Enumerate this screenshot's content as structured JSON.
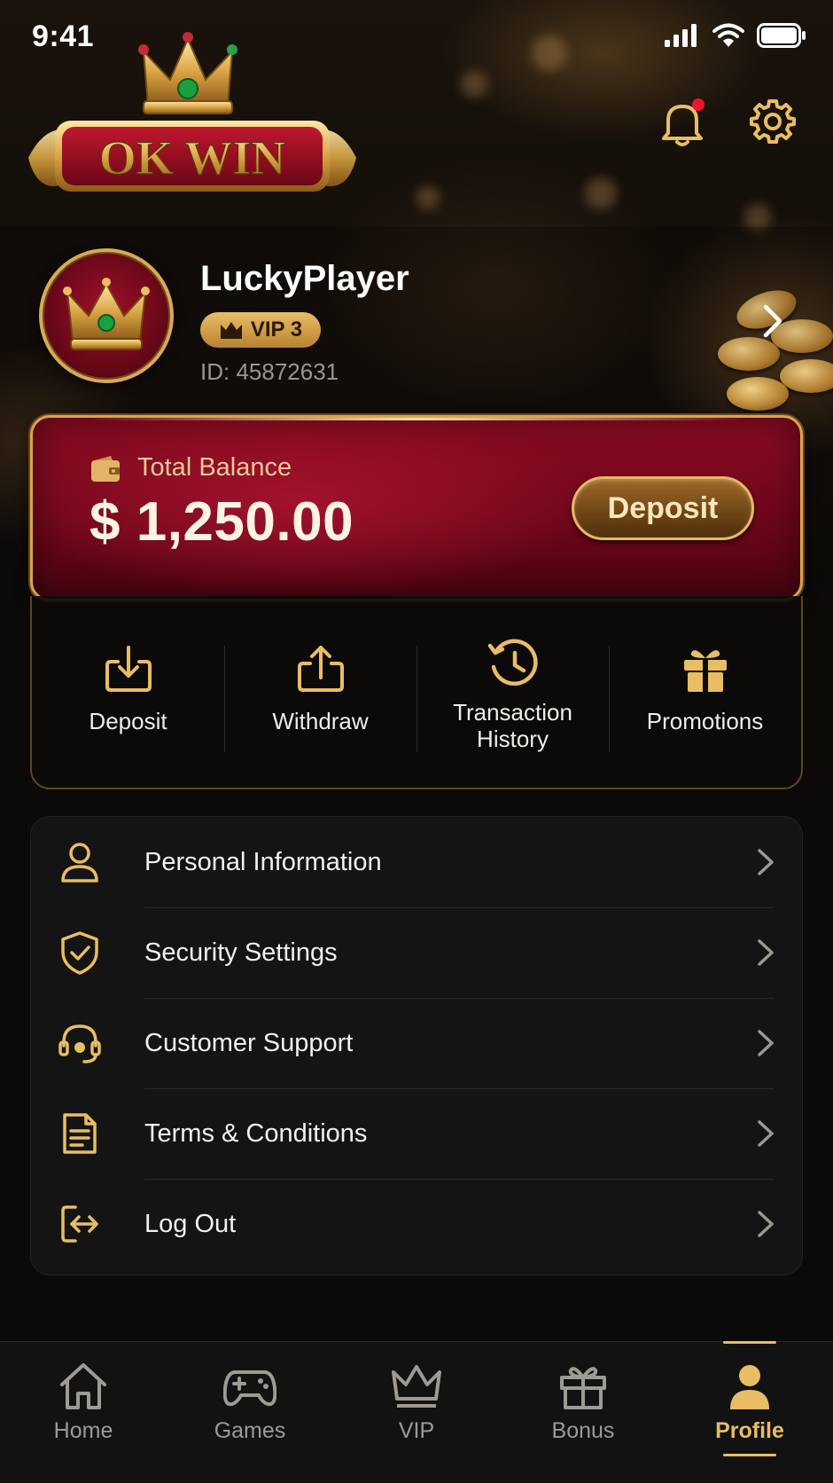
{
  "status_bar": {
    "time": "9:41",
    "icons": [
      "cellular-signal-icon",
      "wifi-icon",
      "battery-icon"
    ]
  },
  "header": {
    "logo_text": "OK WIN",
    "icons": [
      "bell-icon",
      "gear-icon"
    ],
    "notification_dot_color": "#e8182c"
  },
  "profile": {
    "username": "LuckyPlayer",
    "vip_label": "VIP 3",
    "player_id": "ID: 45872631"
  },
  "balance": {
    "label": "Total Balance",
    "amount": "$ 1,250.00",
    "deposit_button": "Deposit"
  },
  "quick_actions": [
    {
      "label": "Deposit",
      "icon": "deposit-icon"
    },
    {
      "label": "Withdraw",
      "icon": "withdraw-icon"
    },
    {
      "label": "Transaction History",
      "icon": "history-icon"
    },
    {
      "label": "Promotions",
      "icon": "gift-icon"
    }
  ],
  "menu": [
    {
      "label": "Personal Information",
      "icon": "user-icon"
    },
    {
      "label": "Security Settings",
      "icon": "shield-check-icon"
    },
    {
      "label": "Customer Support",
      "icon": "headset-icon"
    },
    {
      "label": "Terms & Conditions",
      "icon": "document-icon"
    },
    {
      "label": "Log Out",
      "icon": "logout-icon"
    }
  ],
  "bottom_nav": [
    {
      "label": "Home",
      "icon": "home-icon",
      "active": false
    },
    {
      "label": "Games",
      "icon": "gamepad-icon",
      "active": false
    },
    {
      "label": "VIP",
      "icon": "crown-icon",
      "active": false
    },
    {
      "label": "Bonus",
      "icon": "gift-icon",
      "active": false
    },
    {
      "label": "Profile",
      "icon": "user-icon",
      "active": true
    }
  ],
  "colors": {
    "gold": "#e9bd63",
    "crimson": "#8a0b22",
    "background": "#0a0908",
    "inactive_nav": "#9e9a94"
  }
}
